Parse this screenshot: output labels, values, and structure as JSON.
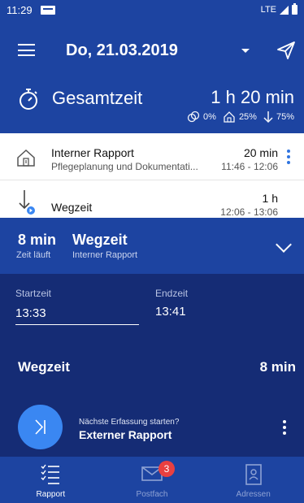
{
  "status_bar": {
    "time": "11:29",
    "network": "LTE"
  },
  "app_bar": {
    "title": "Do, 21.03.2019"
  },
  "summary": {
    "label": "Gesamtzeit",
    "total": "1 h 20 min",
    "stats": {
      "other_pct": "0%",
      "home_pct": "25%",
      "travel_pct": "75%"
    }
  },
  "entries": [
    {
      "title": "Interner Rapport",
      "subtitle": "Pflegeplanung und Dokumentati...",
      "duration": "20 min",
      "range": "11:46 - 12:06"
    },
    {
      "title": "Wegzeit",
      "subtitle": "",
      "duration": "1 h",
      "range": "12:06 - 13:06"
    }
  ],
  "timer": {
    "value": "8 min",
    "value_sub": "Zeit läuft",
    "title": "Wegzeit",
    "title_sub": "Interner Rapport",
    "start_label": "Startzeit",
    "start_value": "13:33",
    "end_label": "Endzeit",
    "end_value": "13:41",
    "type_label": "Wegzeit",
    "type_value": "8 min",
    "next_hint": "Nächste Erfassung starten?",
    "next_title": "Externer Rapport"
  },
  "bottom_nav": {
    "items": [
      {
        "label": "Rapport",
        "icon": "list-check-icon",
        "active": true
      },
      {
        "label": "Postfach",
        "icon": "mail-icon",
        "badge": "3",
        "active": false
      },
      {
        "label": "Adressen",
        "icon": "contacts-icon",
        "active": false
      }
    ]
  },
  "colors": {
    "primary": "#1d44a1",
    "panel": "#152c75",
    "accent": "#3a87f2",
    "badge": "#e94040"
  }
}
